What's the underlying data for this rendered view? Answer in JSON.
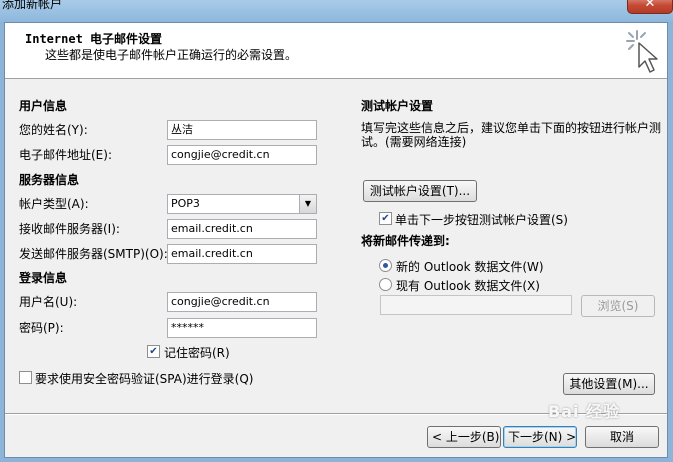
{
  "window": {
    "title": "添加新帐户",
    "close_label": "✕"
  },
  "header": {
    "title": "Internet 电子邮件设置",
    "subtitle": "这些都是使电子邮件帐户正确运行的必需设置。"
  },
  "user_info": {
    "heading": "用户信息",
    "name_label": "您的姓名(Y):",
    "name_value": "丛洁",
    "email_label": "电子邮件地址(E):",
    "email_value": "congjie@credit.cn"
  },
  "server_info": {
    "heading": "服务器信息",
    "account_type_label": "帐户类型(A):",
    "account_type_value": "POP3",
    "incoming_label": "接收邮件服务器(I):",
    "incoming_value": "email.credit.cn",
    "outgoing_label": "发送邮件服务器(SMTP)(O):",
    "outgoing_value": "email.credit.cn"
  },
  "login_info": {
    "heading": "登录信息",
    "username_label": "用户名(U):",
    "username_value": "congjie@credit.cn",
    "password_label": "密码(P):",
    "password_value": "******",
    "remember_label": "记住密码(R)",
    "remember_checked": true,
    "spa_label": "要求使用安全密码验证(SPA)进行登录(Q)",
    "spa_checked": false
  },
  "test": {
    "heading": "测试帐户设置",
    "description": "填写完这些信息之后，建议您单击下面的按钮进行帐户测试。(需要网络连接)",
    "test_button": "测试帐户设置(T)...",
    "auto_test_label": "单击下一步按钮测试帐户设置(S)",
    "auto_test_checked": true
  },
  "delivery": {
    "heading": "将新邮件传递到:",
    "option_new": "新的 Outlook 数据文件(W)",
    "option_existing": "现有 Outlook 数据文件(X)",
    "browse_button": "浏览(S)",
    "existing_path": ""
  },
  "more_settings_button": "其他设置(M)...",
  "footer": {
    "back_button": "< 上一步(B)",
    "next_button": "下一步(N) >",
    "cancel_button": "取消"
  },
  "watermark": "Bai 经验"
}
